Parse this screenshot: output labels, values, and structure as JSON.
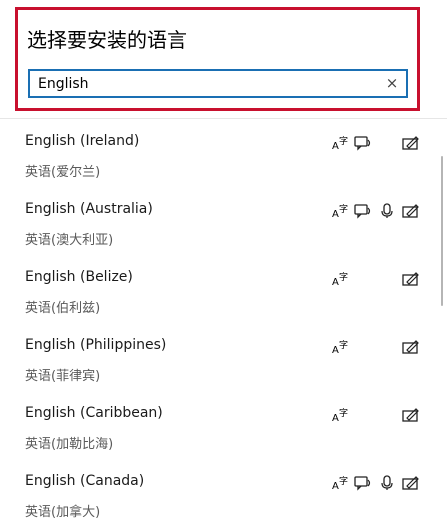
{
  "dialog": {
    "title": "选择要安装的语言",
    "search": {
      "value": "English",
      "placeholder": ""
    },
    "clear_icon": "×"
  },
  "languages": [
    {
      "name": "English (Ireland)",
      "native": "英语(爱尔兰)",
      "features": [
        "display-language",
        "text-to-speech",
        "handwriting"
      ]
    },
    {
      "name": "English (Australia)",
      "native": "英语(澳大利亚)",
      "features": [
        "display-language",
        "text-to-speech",
        "speech-recognition",
        "handwriting"
      ]
    },
    {
      "name": "English (Belize)",
      "native": "英语(伯利兹)",
      "features": [
        "display-language",
        "handwriting"
      ]
    },
    {
      "name": "English (Philippines)",
      "native": "英语(菲律宾)",
      "features": [
        "display-language",
        "handwriting"
      ]
    },
    {
      "name": "English (Caribbean)",
      "native": "英语(加勒比海)",
      "features": [
        "display-language",
        "handwriting"
      ]
    },
    {
      "name": "English (Canada)",
      "native": "英语(加拿大)",
      "features": [
        "display-language",
        "text-to-speech",
        "speech-recognition",
        "handwriting"
      ]
    }
  ],
  "colors": {
    "highlight_border": "#c8102e",
    "search_border": "#1a6fb3"
  }
}
